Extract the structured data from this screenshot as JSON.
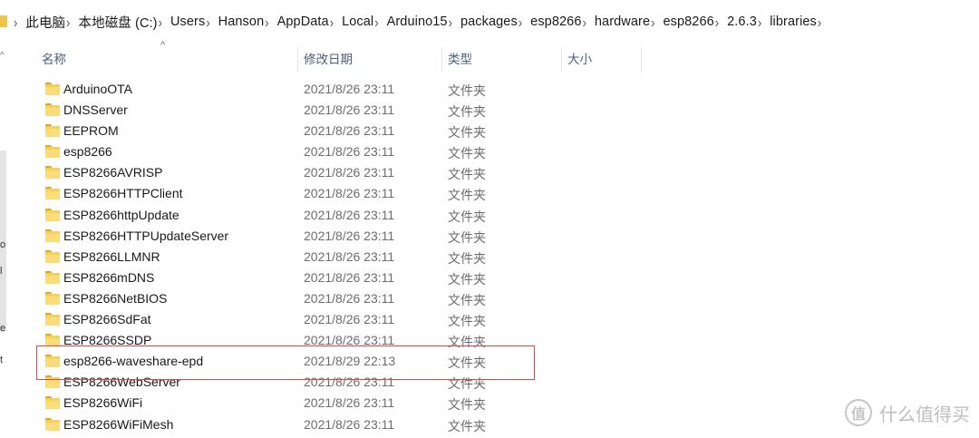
{
  "breadcrumb": [
    "此电脑",
    "本地磁盘 (C:)",
    "Users",
    "Hanson",
    "AppData",
    "Local",
    "Arduino15",
    "packages",
    "esp8266",
    "hardware",
    "esp8266",
    "2.6.3",
    "libraries"
  ],
  "columns": {
    "name": "名称",
    "date": "修改日期",
    "type": "类型",
    "size": "大小"
  },
  "files": [
    {
      "name": "ArduinoOTA",
      "date": "2021/8/26 23:11",
      "type": "文件夹"
    },
    {
      "name": "DNSServer",
      "date": "2021/8/26 23:11",
      "type": "文件夹"
    },
    {
      "name": "EEPROM",
      "date": "2021/8/26 23:11",
      "type": "文件夹"
    },
    {
      "name": "esp8266",
      "date": "2021/8/26 23:11",
      "type": "文件夹"
    },
    {
      "name": "ESP8266AVRISP",
      "date": "2021/8/26 23:11",
      "type": "文件夹"
    },
    {
      "name": "ESP8266HTTPClient",
      "date": "2021/8/26 23:11",
      "type": "文件夹"
    },
    {
      "name": "ESP8266httpUpdate",
      "date": "2021/8/26 23:11",
      "type": "文件夹"
    },
    {
      "name": "ESP8266HTTPUpdateServer",
      "date": "2021/8/26 23:11",
      "type": "文件夹"
    },
    {
      "name": "ESP8266LLMNR",
      "date": "2021/8/26 23:11",
      "type": "文件夹"
    },
    {
      "name": "ESP8266mDNS",
      "date": "2021/8/26 23:11",
      "type": "文件夹"
    },
    {
      "name": "ESP8266NetBIOS",
      "date": "2021/8/26 23:11",
      "type": "文件夹"
    },
    {
      "name": "ESP8266SdFat",
      "date": "2021/8/26 23:11",
      "type": "文件夹"
    },
    {
      "name": "ESP8266SSDP",
      "date": "2021/8/26 23:11",
      "type": "文件夹"
    },
    {
      "name": "esp8266-waveshare-epd",
      "date": "2021/8/29 22:13",
      "type": "文件夹"
    },
    {
      "name": "ESP8266WebServer",
      "date": "2021/8/26 23:11",
      "type": "文件夹"
    },
    {
      "name": "ESP8266WiFi",
      "date": "2021/8/26 23:11",
      "type": "文件夹"
    },
    {
      "name": "ESP8266WiFiMesh",
      "date": "2021/8/26 23:11",
      "type": "文件夹"
    }
  ],
  "nav_fragments": [
    "o",
    "l",
    "e",
    "t"
  ],
  "watermark": {
    "icon": "值",
    "text": "什么值得买"
  },
  "colors": {
    "highlight": "#e04848",
    "folder": "#f7cf59",
    "header_text": "#4c607a"
  }
}
